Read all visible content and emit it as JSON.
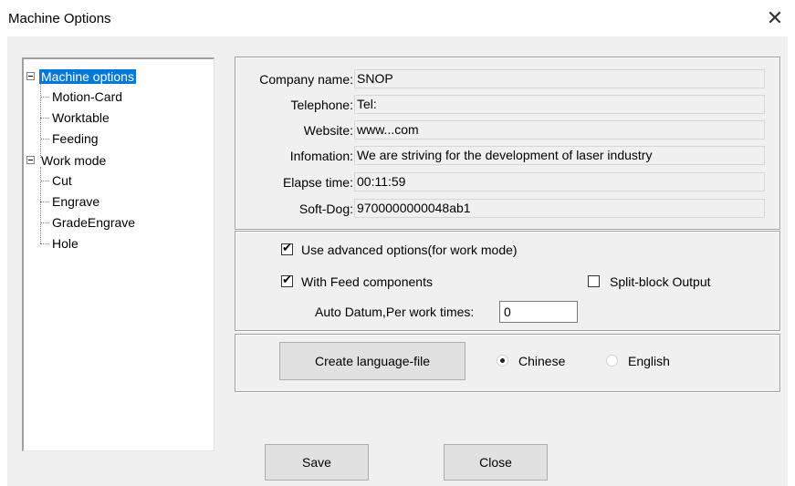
{
  "window": {
    "title": "Machine Options",
    "close_glyph": "✕"
  },
  "tree": {
    "items": [
      {
        "label": "Machine options",
        "selected": true
      },
      {
        "label": "Motion-Card"
      },
      {
        "label": "Worktable"
      },
      {
        "label": "Feeding"
      },
      {
        "label": "Work mode"
      },
      {
        "label": "Cut"
      },
      {
        "label": "Engrave"
      },
      {
        "label": "GradeEngrave"
      },
      {
        "label": "Hole"
      }
    ]
  },
  "info": {
    "company_label": "Company name:",
    "company_value": "SNOP",
    "telephone_label": "Telephone:",
    "telephone_value": "Tel:",
    "website_label": "Website:",
    "website_value": "www...com",
    "information_label": "Infomation:",
    "information_value": "We are striving for the development of laser industry",
    "elapse_label": "Elapse time:",
    "elapse_value": "00:11:59",
    "softdog_label": "Soft-Dog:",
    "softdog_value": "9700000000048ab1"
  },
  "options": {
    "advanced_label": "Use advanced options(for work mode)",
    "advanced_checked": true,
    "feed_label": "With Feed components",
    "feed_checked": true,
    "split_label": "Split-block Output",
    "split_checked": false,
    "auto_datum_label": "Auto Datum,Per work times:",
    "auto_datum_value": "0"
  },
  "language": {
    "create_button": "Create language-file",
    "chinese_label": "Chinese",
    "english_label": "English",
    "selected": "Chinese"
  },
  "footer": {
    "save_label": "Save",
    "close_label": "Close"
  }
}
